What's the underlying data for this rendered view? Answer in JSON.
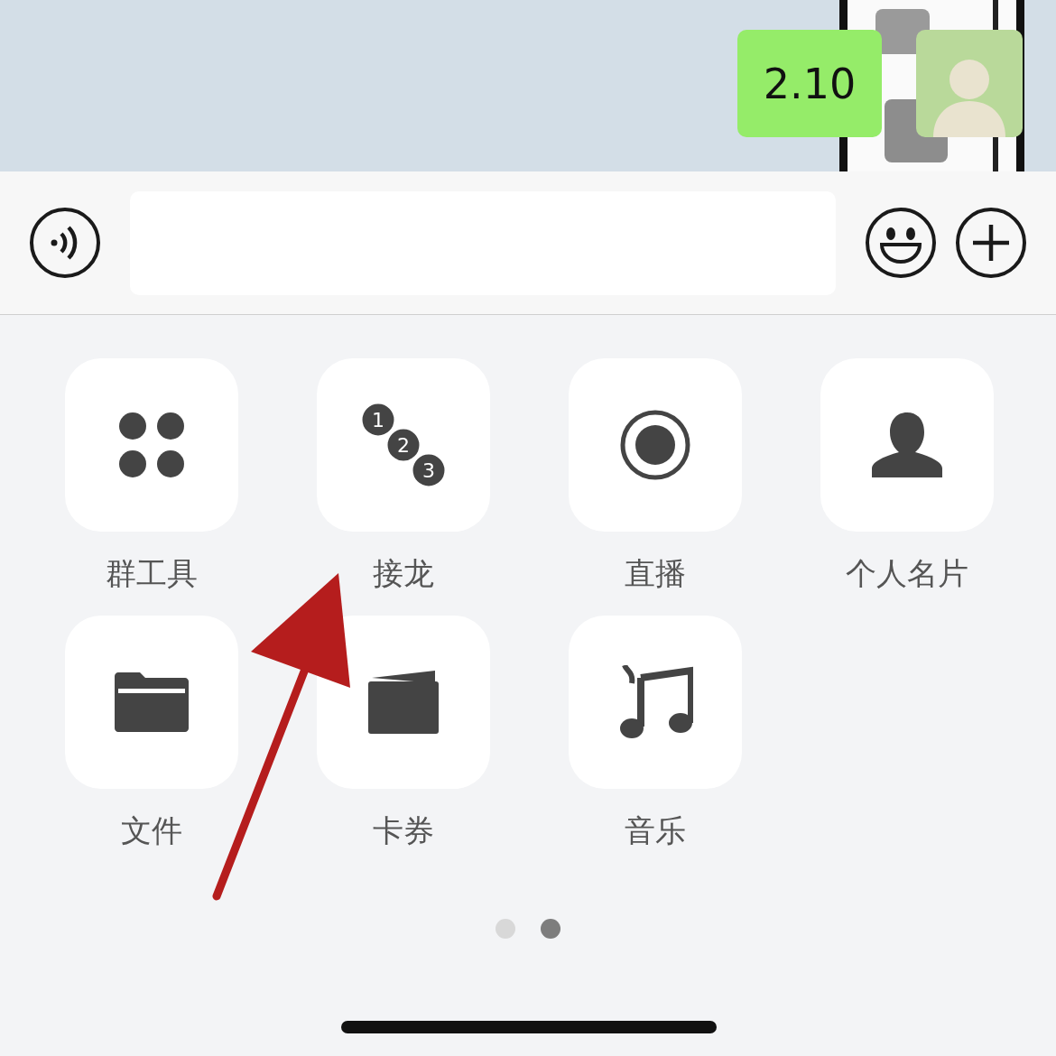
{
  "chat": {
    "messages": [
      {
        "text": "2.10",
        "kind": "outgoing"
      }
    ]
  },
  "input_bar": {
    "buttons": [
      {
        "kind": "voice"
      },
      {
        "kind": "emoji"
      },
      {
        "kind": "plus"
      }
    ]
  },
  "panel": {
    "items": [
      {
        "label": "群工具",
        "kind": "apps"
      },
      {
        "label": "接龙",
        "kind": "numbers",
        "icon_text": [
          "1",
          "2",
          "3"
        ]
      },
      {
        "label": "直播",
        "kind": "live"
      },
      {
        "label": "个人名片",
        "kind": "contact"
      },
      {
        "label": "文件",
        "kind": "folder"
      },
      {
        "label": "卡券",
        "kind": "wallet"
      },
      {
        "label": "音乐",
        "kind": "music"
      }
    ]
  },
  "pager": [
    {
      "selected": false
    },
    {
      "selected": true
    }
  ]
}
